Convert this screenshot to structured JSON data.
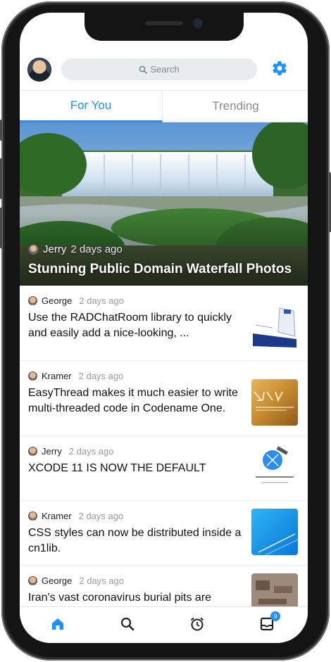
{
  "header": {
    "search_placeholder": "Search"
  },
  "tabs": [
    {
      "label": "For You",
      "active": true
    },
    {
      "label": "Trending",
      "active": false
    }
  ],
  "hero": {
    "author": "Jerry",
    "time_ago": "2 days ago",
    "title": "Stunning Public Domain Waterfall Photos"
  },
  "feed": [
    {
      "author": "George",
      "time_ago": "2 days ago",
      "text": "Use the RADChatRoom library to quickly and easily add a nice-looking, ...",
      "thumb": "chat-screenshot"
    },
    {
      "author": "Kramer",
      "time_ago": "2 days ago",
      "text": "EasyThread  makes it much easier to write multi-threaded code in Codename One.",
      "thumb": "new-features"
    },
    {
      "author": "Jerry",
      "time_ago": "2 days ago",
      "text": "XCODE 11 IS NOW THE DEFAULT",
      "thumb": "xcode-welcome"
    },
    {
      "author": "Kramer",
      "time_ago": "2 days ago",
      "text": "CSS styles can now be distributed inside a cn1lib.",
      "thumb": "blue-abstract"
    },
    {
      "author": "George",
      "time_ago": "2 days ago",
      "text": "Iran's vast coronavirus burial pits are visible in satellite ...",
      "thumb": "satellite-photo"
    }
  ],
  "bottom_nav": {
    "items": [
      "home-icon",
      "search-icon",
      "alarm-icon",
      "inbox-icon"
    ],
    "inbox_badge": "9"
  },
  "colors": {
    "accent": "#1e90ff",
    "inactive": "#8a8a8a"
  }
}
